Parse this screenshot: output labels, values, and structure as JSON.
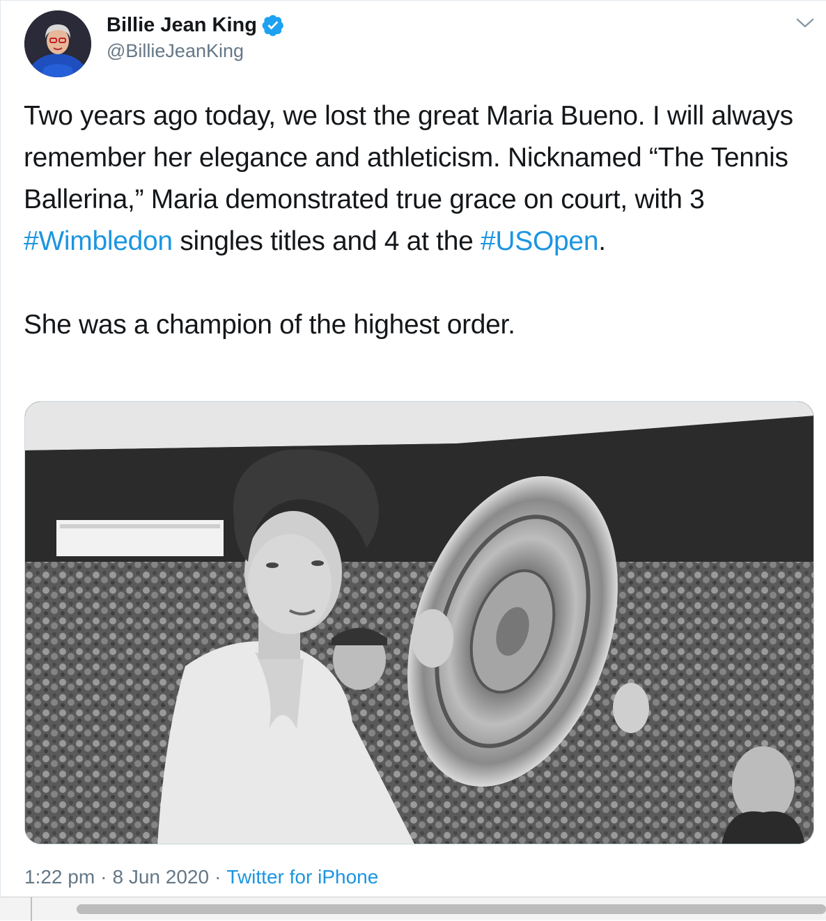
{
  "tweet": {
    "author": {
      "display_name": "Billie Jean King",
      "handle": "@BillieJeanKing",
      "verified": true
    },
    "paragraph1": {
      "part1": "Two years ago today, we lost the great Maria Bueno. I will always remember her elegance and athleticism. Nicknamed “The Tennis Ballerina,” Maria demonstrated true grace on court, with 3 ",
      "hashtag1": "#Wimbledon",
      "part2": " singles titles and 4 at the ",
      "hashtag2": "#USOpen",
      "part3": "."
    },
    "paragraph2": "She was a champion of the highest order.",
    "timestamp": {
      "time": "1:22 pm",
      "separator": "·",
      "date": "8 Jun 2020",
      "source": "Twitter for iPhone"
    }
  },
  "colors": {
    "link": "#1b95e0",
    "verified": "#1da1f2",
    "secondary_text": "#657786",
    "primary_text": "#14171a"
  },
  "icons": {
    "verified": "verified-badge-icon",
    "caret": "chevron-down-icon"
  }
}
